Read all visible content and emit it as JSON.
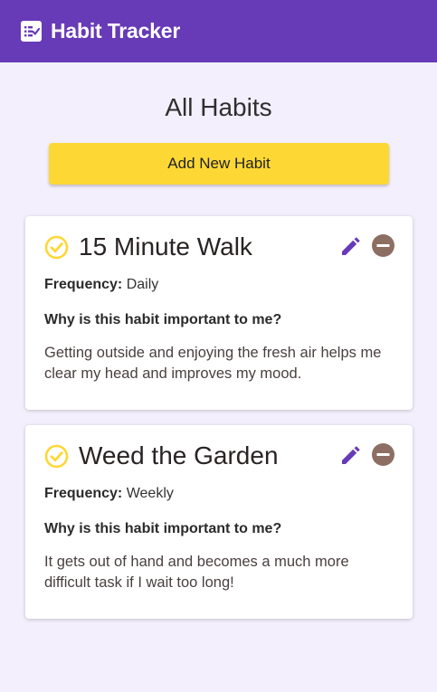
{
  "header": {
    "app_title": "Habit Tracker",
    "icon": "checklist-icon",
    "background": "#673ab7"
  },
  "main": {
    "page_title": "All Habits",
    "add_button_label": "Add New Habit",
    "add_button_color": "#fdd835"
  },
  "habits": [
    {
      "name": "15 Minute Walk",
      "frequency_label": "Frequency:",
      "frequency_value": "Daily",
      "why_heading": "Why is this habit important to me?",
      "reason": "Getting outside and enjoying the fresh air helps me clear my head and improves my mood."
    },
    {
      "name": "Weed the Garden",
      "frequency_label": "Frequency:",
      "frequency_value": "Weekly",
      "why_heading": "Why is this habit important to me?",
      "reason": "It gets out of hand and becomes a much more difficult task if I wait too long!"
    }
  ],
  "icons": {
    "status": "check-circle-icon",
    "edit": "pencil-icon",
    "delete": "minus-circle-icon"
  },
  "colors": {
    "check": "#fdd835",
    "edit": "#673ab7",
    "delete": "#8d6e63",
    "page_background": "#f3effc"
  }
}
